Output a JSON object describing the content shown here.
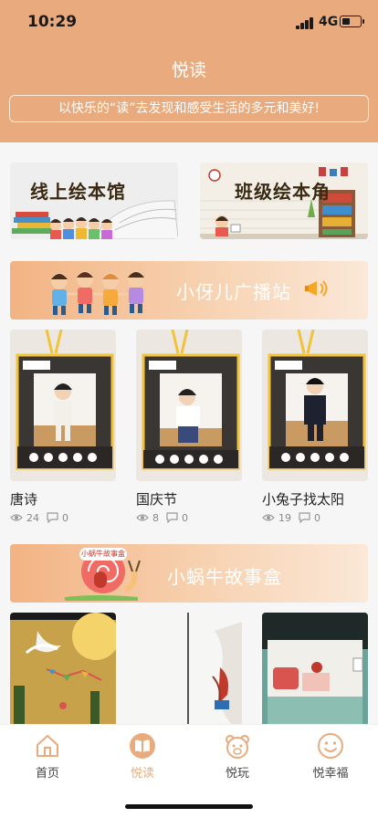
{
  "status": {
    "time": "10:29",
    "network": "4G",
    "battery_level": 0.45
  },
  "header": {
    "title": "悦读",
    "slogan": "以快乐的“读”去发现和感受生活的多元和美好!"
  },
  "features": [
    {
      "label": "线上绘本馆"
    },
    {
      "label": "班级绘本角"
    }
  ],
  "broadcast": {
    "title": "小伢儿广播站",
    "videos": [
      {
        "title": "唐诗",
        "views": "24",
        "comments": "0"
      },
      {
        "title": "国庆节",
        "views": "8",
        "comments": "0"
      },
      {
        "title": "小兔子找太阳",
        "views": "19",
        "comments": "0"
      }
    ]
  },
  "story_box": {
    "title": "小蜗牛故事盒",
    "badge": "小蜗牛故事盒"
  },
  "tabs": [
    {
      "label": "首页",
      "icon": "home-icon"
    },
    {
      "label": "悦读",
      "icon": "book-icon",
      "active": true
    },
    {
      "label": "悦玩",
      "icon": "bear-icon"
    },
    {
      "label": "悦幸福",
      "icon": "smile-icon"
    }
  ],
  "colors": {
    "header": "#e9ab7e",
    "accent": "#e9ab7e"
  }
}
